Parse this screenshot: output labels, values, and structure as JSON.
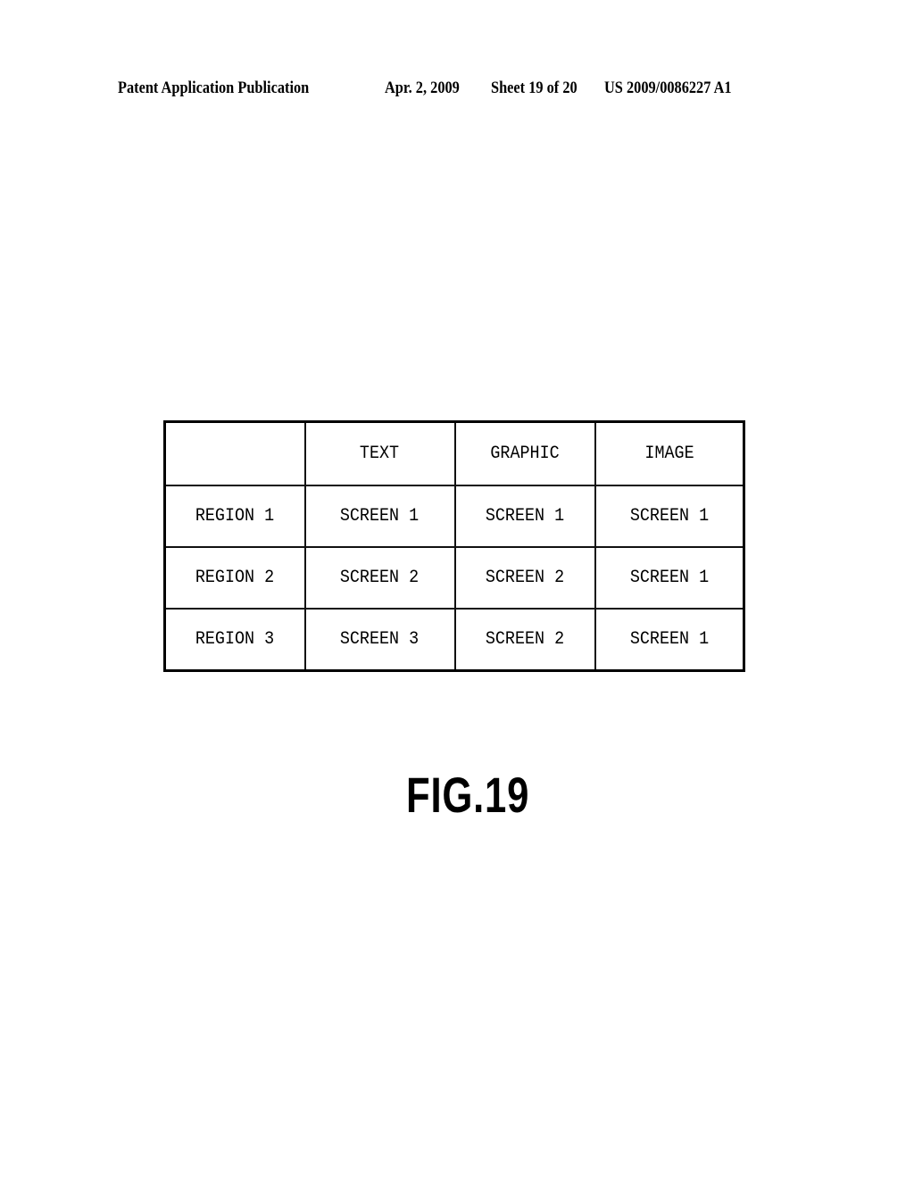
{
  "header": {
    "publication": "Patent Application Publication",
    "date": "Apr. 2, 2009",
    "sheet": "Sheet 19 of 20",
    "number": "US 2009/0086227 A1"
  },
  "table": {
    "columns": [
      "",
      "TEXT",
      "GRAPHIC",
      "IMAGE"
    ],
    "rows": [
      [
        "REGION 1",
        "SCREEN 1",
        "SCREEN 1",
        "SCREEN 1"
      ],
      [
        "REGION 2",
        "SCREEN 2",
        "SCREEN 2",
        "SCREEN 1"
      ],
      [
        "REGION 3",
        "SCREEN 3",
        "SCREEN 2",
        "SCREEN 1"
      ]
    ]
  },
  "figure": {
    "label": "FIG.19"
  }
}
